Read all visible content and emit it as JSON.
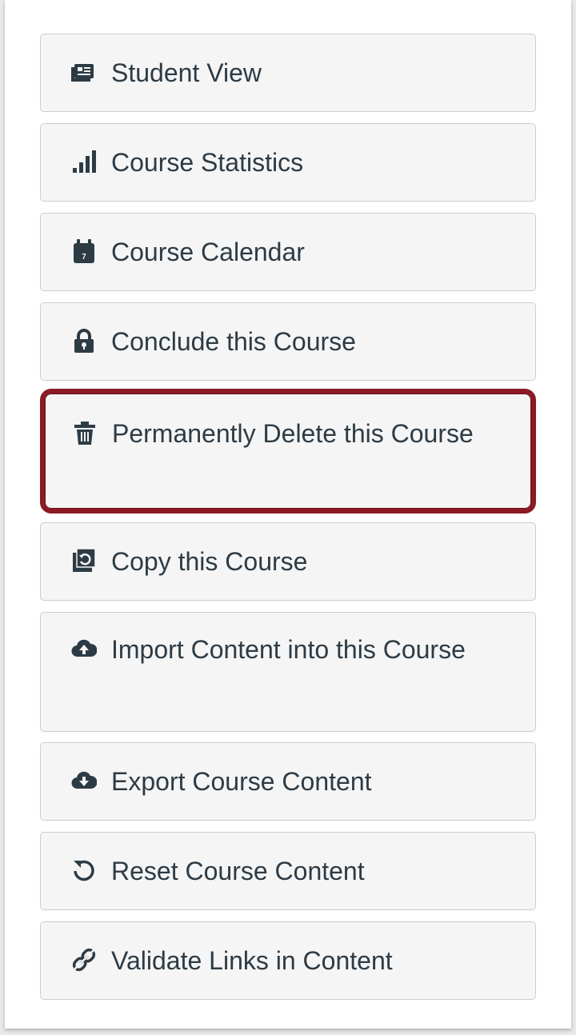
{
  "sidebar": {
    "items": [
      {
        "label": "Student View",
        "icon": "student-view-icon"
      },
      {
        "label": "Course Statistics",
        "icon": "bar-chart-icon"
      },
      {
        "label": "Course Calendar",
        "icon": "calendar-icon",
        "icon_text": "7"
      },
      {
        "label": "Conclude this Course",
        "icon": "lock-icon"
      },
      {
        "label": "Permanently Delete this Course",
        "icon": "trash-icon",
        "highlighted": true
      },
      {
        "label": "Copy this Course",
        "icon": "copy-course-icon"
      },
      {
        "label": "Import Content into this Course",
        "icon": "cloud-upload-icon"
      },
      {
        "label": "Export Course Content",
        "icon": "cloud-download-icon"
      },
      {
        "label": "Reset Course Content",
        "icon": "reset-icon"
      },
      {
        "label": "Validate Links in Content",
        "icon": "validate-links-icon"
      }
    ]
  },
  "colors": {
    "text": "#2d3b45",
    "button_bg": "#f5f5f5",
    "highlight_border": "#8b1a24"
  }
}
